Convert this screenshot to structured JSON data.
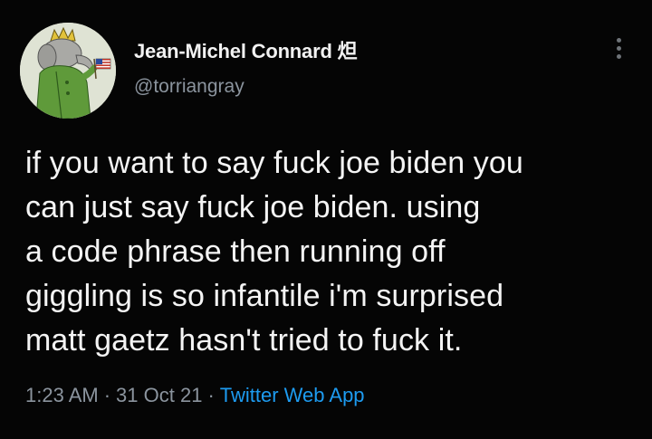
{
  "author": {
    "display_name": "Jean-Michel Connard 炟",
    "handle": "@torriangray",
    "avatar_icon": "elephant-avatar-with-flag"
  },
  "menu_icon": "more-vertical-icon",
  "tweet": {
    "lines": [
      "if you want to say fuck joe biden you",
      "can just say fuck joe biden. using",
      "a code phrase then running off",
      "giggling is so infantile i'm surprised",
      "matt gaetz hasn't tried to fuck it."
    ]
  },
  "meta": {
    "time": "1:23 AM",
    "date": "31 Oct 21",
    "separator": "·",
    "source": "Twitter Web App"
  },
  "colors": {
    "background": "#050505",
    "text": "#f4f4f4",
    "muted": "#8b949e",
    "link": "#1d9bf0"
  }
}
